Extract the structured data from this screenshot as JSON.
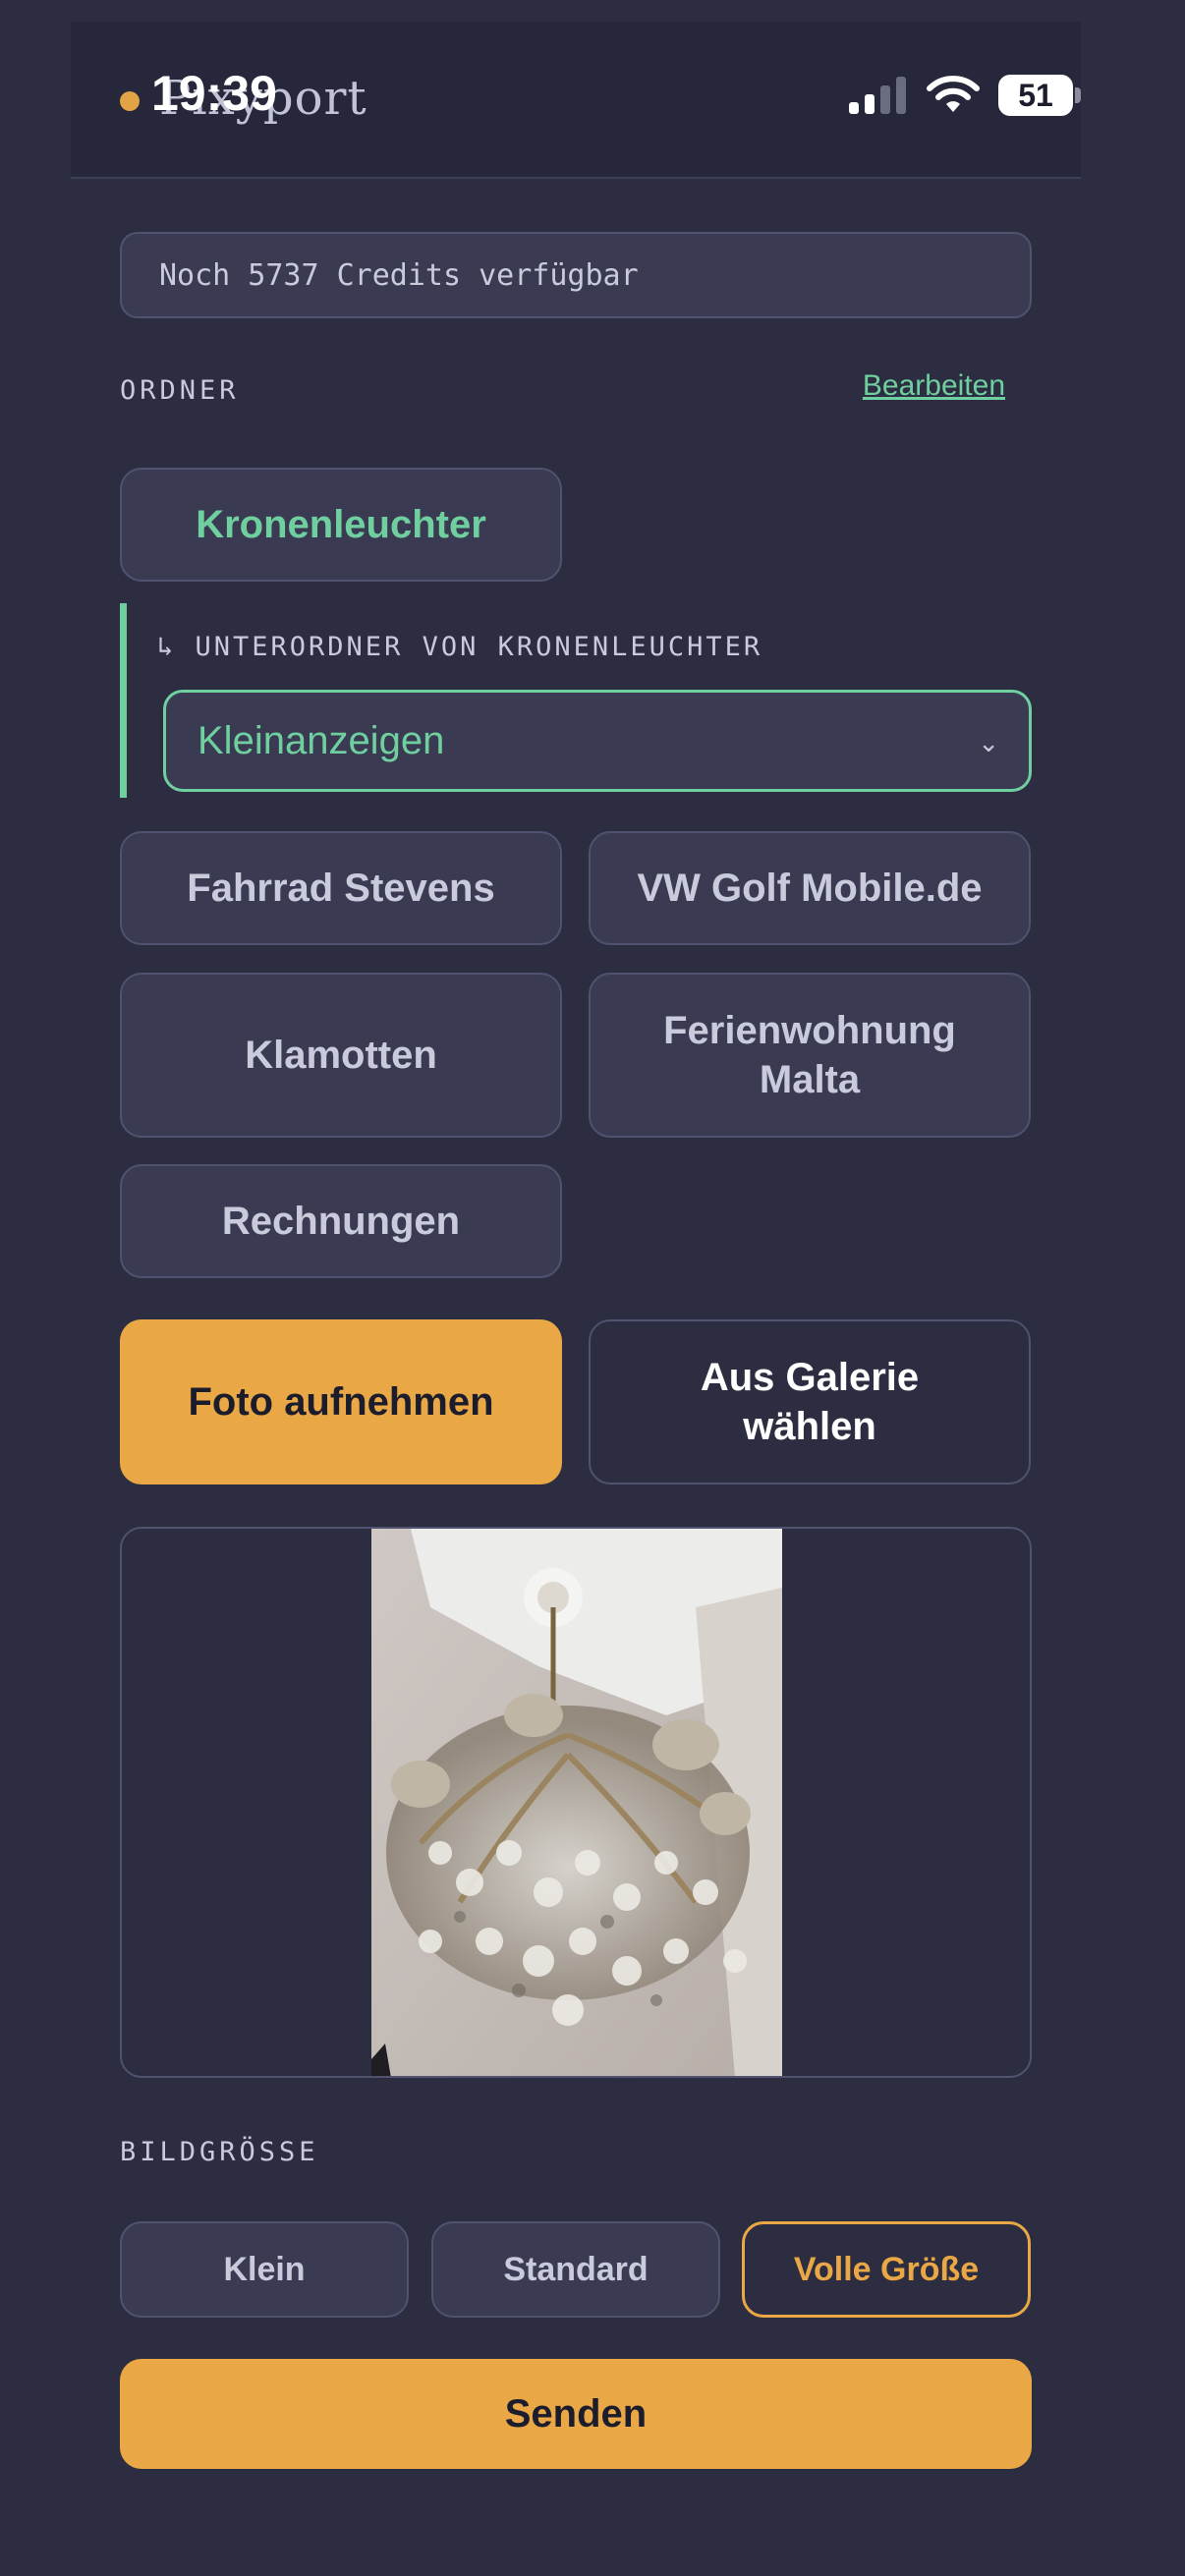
{
  "app": {
    "name": "Pixyport",
    "accent_color": "#e9a845",
    "highlight_color": "#6fcf9f",
    "background_color": "#2c2d40"
  },
  "status_bar": {
    "time": "19:39",
    "battery": "51",
    "icons": [
      "signal-icon",
      "wifi-icon",
      "battery-icon"
    ]
  },
  "credits": {
    "text": "Noch 5737 Credits verfügbar"
  },
  "folders": {
    "label": "ORDNER",
    "edit_label": "Bearbeiten",
    "selected": "Kronenleuchter",
    "subfolder_label": "↳ UNTERORDNER VON KRONENLEUCHTER",
    "subfolder_selected": "Kleinanzeigen",
    "chevron": "⌄",
    "items": [
      "Fahrrad Stevens",
      "VW Golf Mobile.de",
      "Klamotten",
      "Ferienwohnung Malta",
      "Rechnungen"
    ]
  },
  "actions": {
    "take_photo": "Foto aufnehmen",
    "from_gallery": "Aus Galerie wählen"
  },
  "image_size": {
    "label": "BILDGRÖSSE",
    "options": [
      "Klein",
      "Standard",
      "Volle Größe"
    ],
    "selected": "Volle Größe"
  },
  "send_label": "Senden"
}
